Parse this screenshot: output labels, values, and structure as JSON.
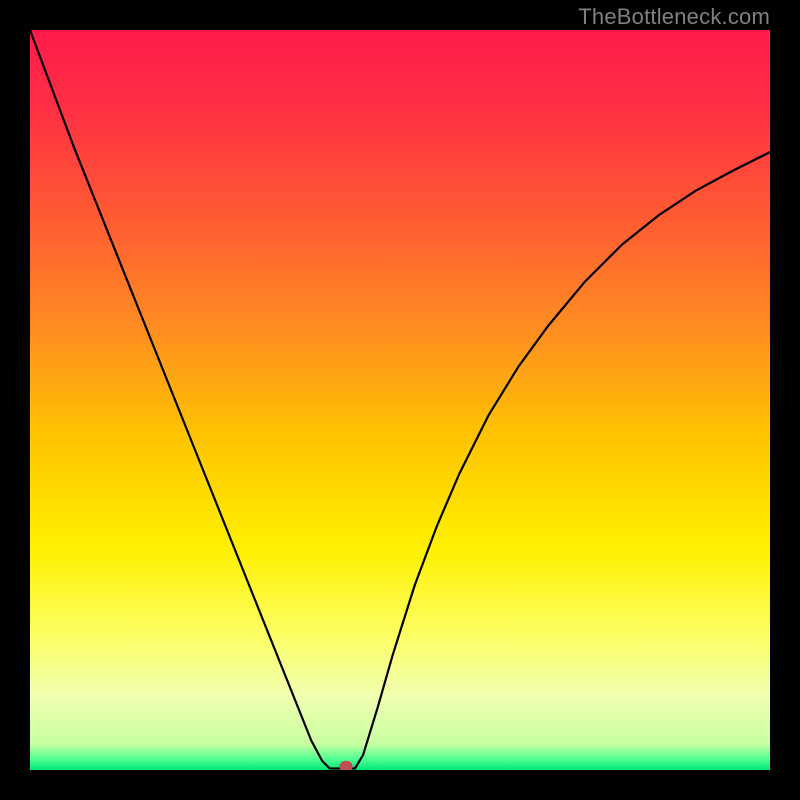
{
  "watermark": "TheBottleneck.com",
  "chart_data": {
    "type": "line",
    "title": "",
    "xlabel": "",
    "ylabel": "",
    "xlim": [
      0,
      100
    ],
    "ylim": [
      0,
      100
    ],
    "grid": false,
    "legend": false,
    "gradient_stops": [
      {
        "offset": 0.0,
        "color": "#ff1a4b"
      },
      {
        "offset": 0.1,
        "color": "#ff2e44"
      },
      {
        "offset": 0.25,
        "color": "#ff5a33"
      },
      {
        "offset": 0.4,
        "color": "#ff8c22"
      },
      {
        "offset": 0.55,
        "color": "#ffc400"
      },
      {
        "offset": 0.7,
        "color": "#fff000"
      },
      {
        "offset": 0.82,
        "color": "#fcff66"
      },
      {
        "offset": 0.9,
        "color": "#f0ffb0"
      },
      {
        "offset": 0.965,
        "color": "#c8ffa0"
      },
      {
        "offset": 0.985,
        "color": "#50ff90"
      },
      {
        "offset": 1.0,
        "color": "#00e878"
      }
    ],
    "series": [
      {
        "name": "bottleneck-curve",
        "color": "#000000",
        "stroke_width": 2.2,
        "x": [
          0.0,
          3.0,
          6.0,
          9.0,
          12.0,
          15.0,
          18.0,
          21.0,
          24.0,
          27.0,
          30.0,
          33.0,
          36.0,
          38.0,
          39.5,
          40.5,
          41.6,
          43.9,
          45.0,
          47.0,
          49.0,
          52.0,
          55.0,
          58.0,
          62.0,
          66.0,
          70.0,
          75.0,
          80.0,
          85.0,
          90.0,
          95.0,
          100.0
        ],
        "y": [
          100.0,
          92.0,
          84.0,
          76.5,
          69.0,
          61.5,
          54.0,
          46.5,
          39.0,
          31.5,
          24.0,
          16.5,
          9.0,
          4.0,
          1.2,
          0.2,
          0.2,
          0.2,
          2.0,
          8.5,
          15.5,
          25.0,
          33.0,
          40.0,
          48.0,
          54.5,
          60.0,
          66.0,
          71.0,
          75.0,
          78.3,
          81.0,
          83.5
        ]
      }
    ],
    "marker": {
      "x": 42.7,
      "y": 0.5,
      "rx": 0.9,
      "ry": 0.75,
      "color": "#c14f4f"
    }
  }
}
